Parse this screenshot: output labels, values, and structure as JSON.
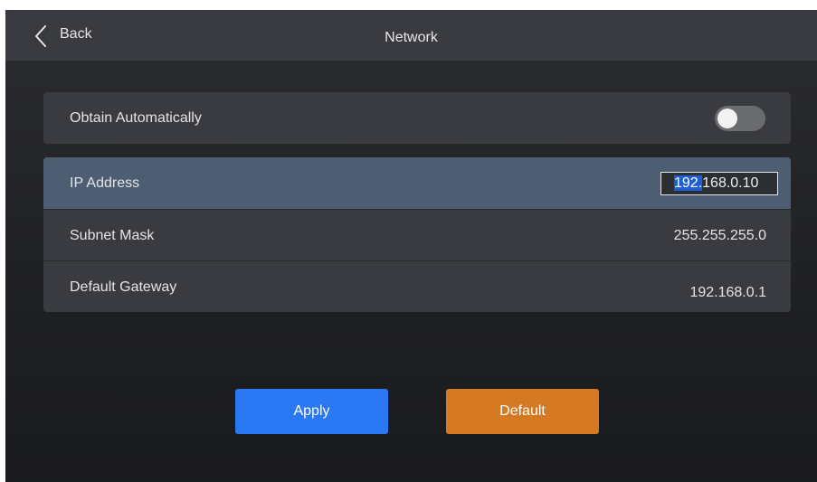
{
  "header": {
    "back_label": "Back",
    "back_icon": "chevron-left-icon",
    "title": "Network"
  },
  "obtain_auto": {
    "label": "Obtain Automatically",
    "enabled": false
  },
  "fields": {
    "ip_address": {
      "label": "IP Address",
      "value_selected": "192.",
      "value_rest": "168.0.10"
    },
    "subnet_mask": {
      "label": "Subnet Mask",
      "value": "255.255.255.0"
    },
    "default_gateway": {
      "label": "Default Gateway",
      "value": "192.168.0.1"
    }
  },
  "actions": {
    "apply_label": "Apply",
    "default_label": "Default"
  },
  "colors": {
    "apply": "#2b78f5",
    "default": "#d57a23",
    "selected_row": "#4d5e72",
    "text_selection": "#1e5fd6"
  }
}
